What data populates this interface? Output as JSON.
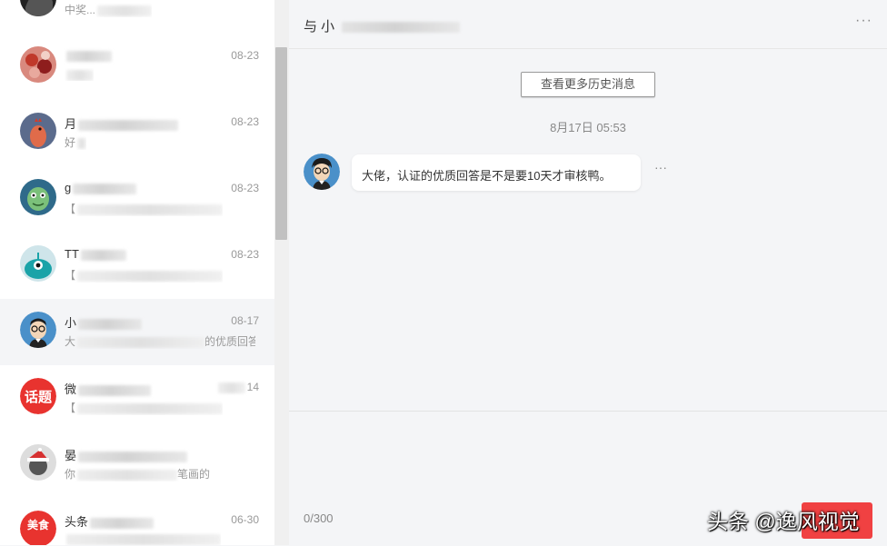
{
  "conversations": [
    {
      "name": "",
      "date": "",
      "preview": "中奖...",
      "avatar": "photo-dark"
    },
    {
      "name": "",
      "date": "08-23",
      "preview": "",
      "avatar": "photo-red"
    },
    {
      "name": "月",
      "date": "08-23",
      "preview": "好",
      "avatar": "rooster"
    },
    {
      "name": "g",
      "date": "08-23",
      "preview": "【",
      "avatar": "green-cartoon"
    },
    {
      "name": "TT",
      "date": "08-23",
      "preview": "【",
      "avatar": "teal-cartoon"
    },
    {
      "name": "小",
      "date": "08-17",
      "preview": "大",
      "preview2": "的优质回答是不",
      "avatar": "glasses-boy"
    },
    {
      "name": "微",
      "date": "14",
      "preview": "【",
      "avatar": "topic-badge"
    },
    {
      "name": "晏",
      "date": "",
      "preview": "你",
      "preview2": "笔画的",
      "avatar": "xmas-photo"
    },
    {
      "name": "头条",
      "date": "06-30",
      "preview": "",
      "avatar": "food-badge"
    }
  ],
  "badges": {
    "topic": "话题",
    "food": "美食"
  },
  "chat": {
    "title_prefix": "与 小",
    "more_icon": "···",
    "history_button": "查看更多历史消息",
    "timestamp": "8月17日 05:53",
    "message": "大佬，认证的优质回答是不是要10天才审核鸭。",
    "message_more": "···",
    "char_counter": "0/300"
  },
  "watermark": "头条 @逸风视觉",
  "colors": {
    "accent": "#f04142",
    "background": "#f4f5f7"
  }
}
